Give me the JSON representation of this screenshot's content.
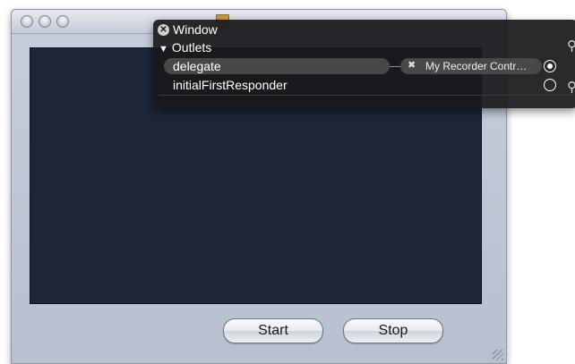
{
  "app_window": {
    "title_icon": "document-proxy-icon"
  },
  "buttons": {
    "start_label": "Start",
    "stop_label": "Stop"
  },
  "hud": {
    "title": "Window",
    "close_icon": "close-icon",
    "section": {
      "disclosure_glyph": "▼",
      "label": "Outlets"
    },
    "outlets": [
      {
        "name": "delegate",
        "connected": true,
        "target": "My Recorder Contr…",
        "remove_glyph": "✖"
      },
      {
        "name": "initialFirstResponder",
        "connected": false
      }
    ]
  },
  "colors": {
    "content_view": "#1c2638",
    "window_background": "#c6cedb",
    "hud_background": "#1a1a1c"
  }
}
